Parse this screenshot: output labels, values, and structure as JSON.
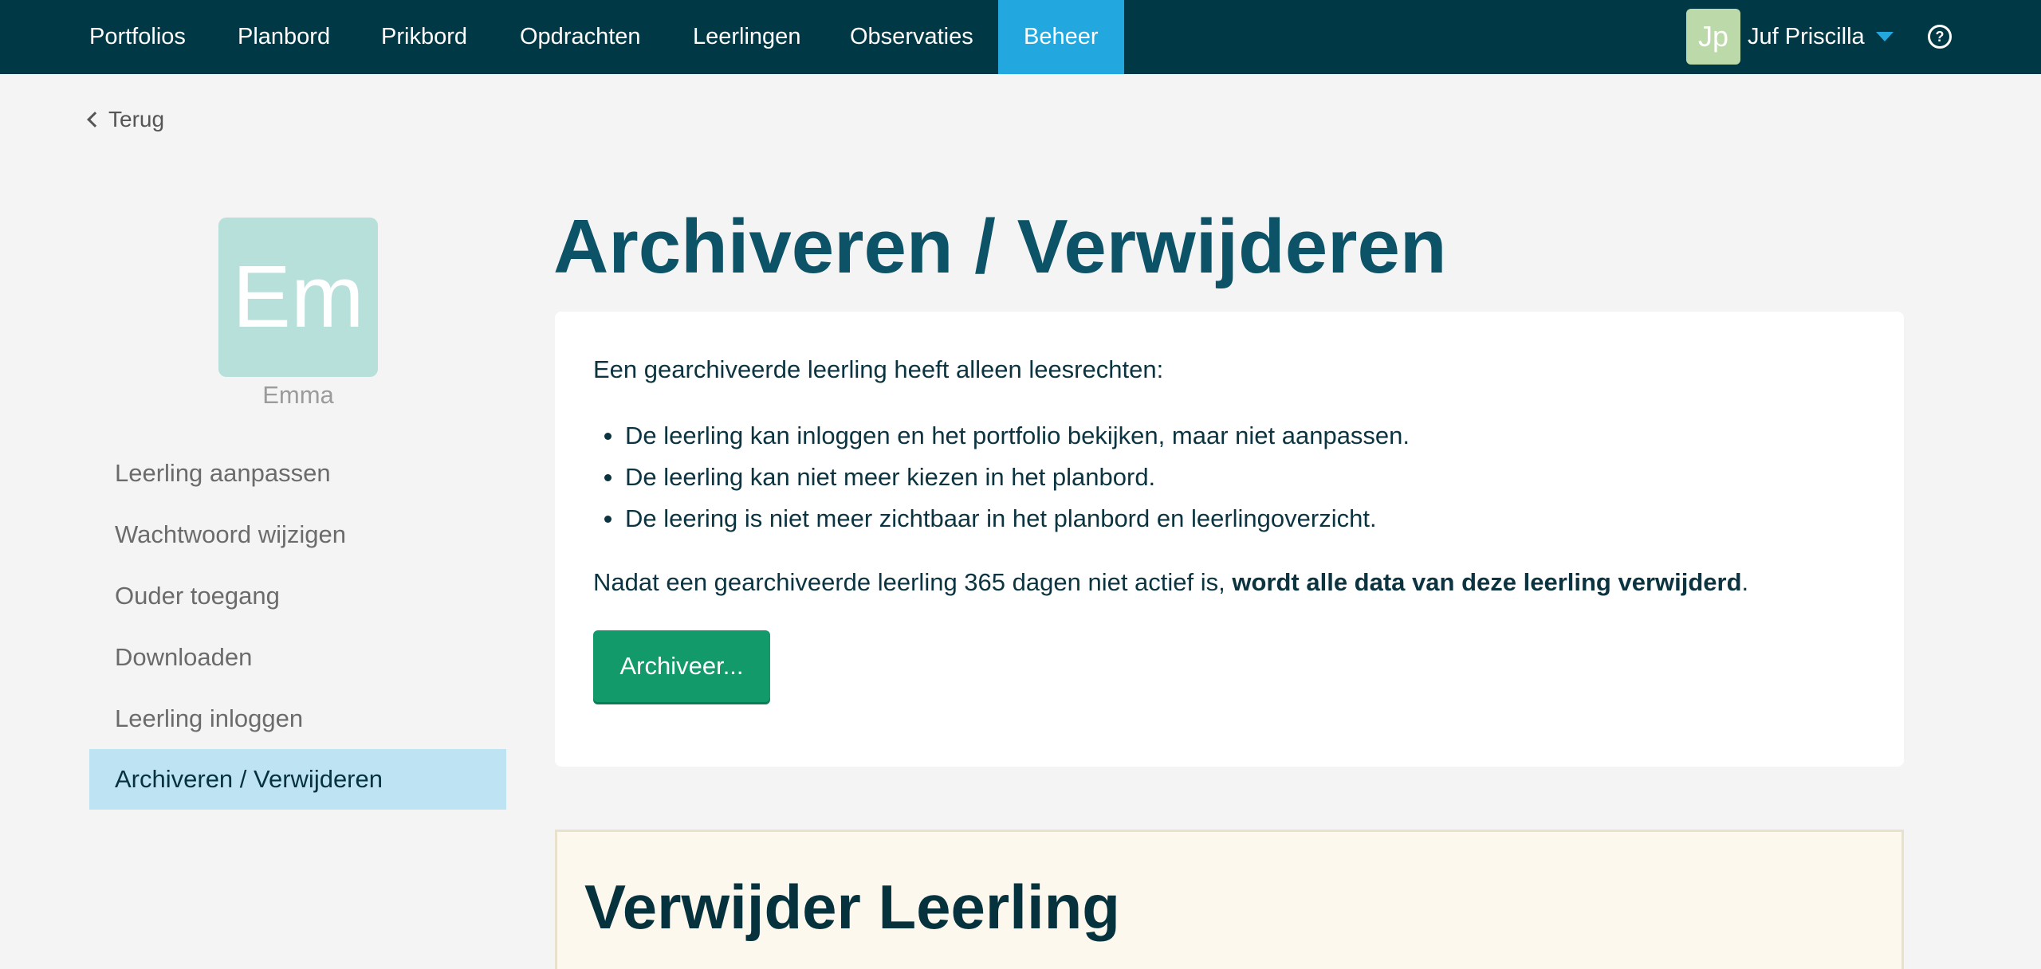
{
  "nav": {
    "items": [
      {
        "label": "Portfolios"
      },
      {
        "label": "Planbord"
      },
      {
        "label": "Prikbord"
      },
      {
        "label": "Opdrachten"
      },
      {
        "label": "Leerlingen"
      },
      {
        "label": "Observaties"
      },
      {
        "label": "Beheer",
        "active": true
      }
    ],
    "user": {
      "initials": "Jp",
      "name": "Juf Priscilla"
    },
    "help_symbol": "?"
  },
  "back_label": "Terug",
  "student": {
    "initials": "Em",
    "name": "Emma"
  },
  "sidebar": {
    "items": [
      {
        "label": "Leerling aanpassen"
      },
      {
        "label": "Wachtwoord wijzigen"
      },
      {
        "label": "Ouder toegang"
      },
      {
        "label": "Downloaden"
      },
      {
        "label": "Leerling inloggen"
      },
      {
        "label": "Archiveren / Verwijderen",
        "active": true
      }
    ]
  },
  "main": {
    "title": "Archiveren / Verwijderen",
    "intro": "Een gearchiveerde leerling heeft alleen leesrechten:",
    "bullets": [
      "De leerling kan inloggen en het portfolio bekijken, maar niet aanpassen.",
      "De leerling kan niet meer kiezen in het planbord.",
      "De leering is niet meer zichtbaar in het planbord en leerlingoverzicht."
    ],
    "note_prefix": "Nadat een gearchiveerde leerling 365 dagen niet actief is, ",
    "note_bold": "wordt alle data van deze leerling verwijderd",
    "note_suffix": ".",
    "archive_button": "Archiveer..."
  },
  "delete_section": {
    "title": "Verwijder Leerling"
  },
  "colors": {
    "nav_bg": "#013846",
    "nav_active": "#22a7df",
    "title": "#0c5367",
    "button": "#129a6b",
    "sidebar_active": "#bee4f4",
    "student_avatar": "#b8e0da",
    "user_avatar": "#bcd9a9"
  }
}
